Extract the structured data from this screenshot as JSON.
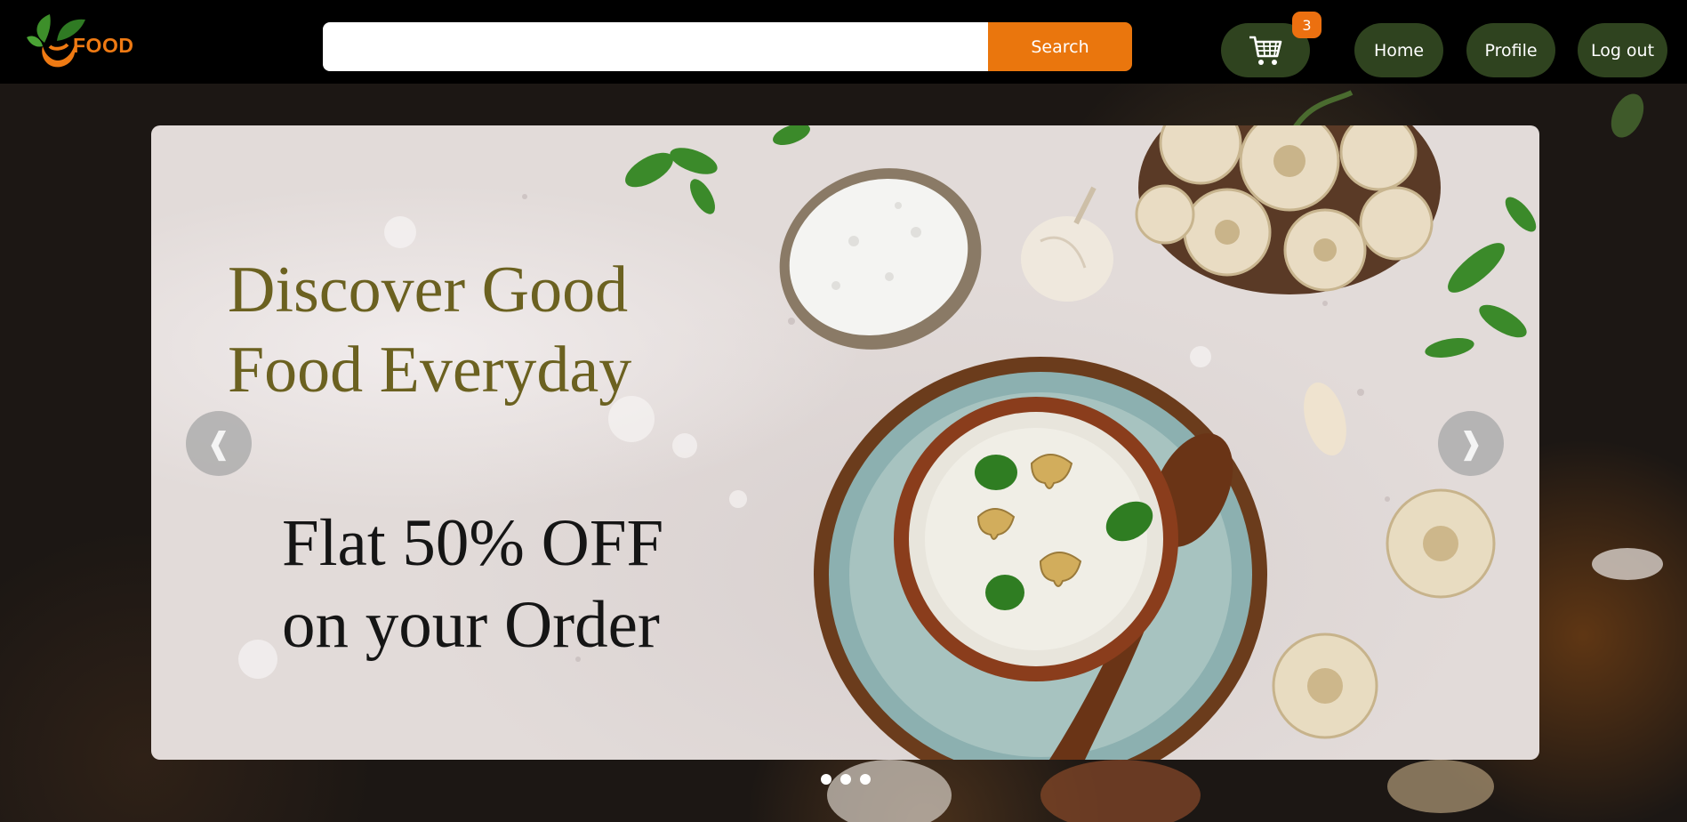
{
  "header": {
    "logo_text": "FOOD",
    "search": {
      "value": "",
      "placeholder": "",
      "button_label": "Search"
    },
    "cart": {
      "badge_count": "3",
      "icon": "shopping-cart-icon"
    },
    "nav": [
      {
        "label": "Home"
      },
      {
        "label": "Profile"
      },
      {
        "label": "Log out"
      }
    ]
  },
  "carousel": {
    "slide": {
      "headline_lines": [
        "Discover Good",
        "Food Everyday"
      ],
      "offer_lines": [
        "Flat 50% OFF",
        "on your Order"
      ]
    },
    "prev_icon": "❰",
    "next_icon": "❱",
    "dot_count": 3,
    "active_index": 0
  },
  "colors": {
    "accent_orange": "#ea760d",
    "nav_green": "#2f431f",
    "headline_olive": "#6b6120"
  }
}
